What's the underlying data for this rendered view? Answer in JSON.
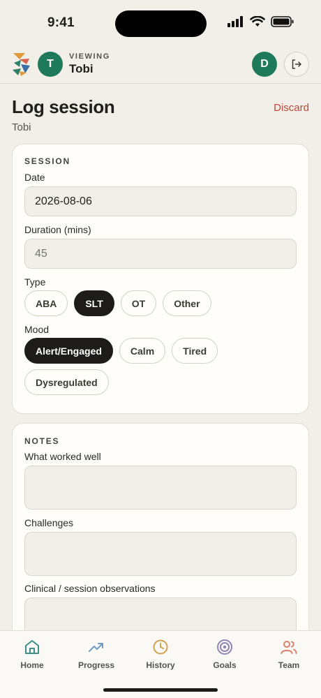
{
  "status_bar": {
    "time": "9:41"
  },
  "header": {
    "child_initial": "T",
    "viewing_label": "VIEWING",
    "child_name": "Tobi",
    "user_initial": "D"
  },
  "page": {
    "title": "Log session",
    "subtitle": "Tobi",
    "discard_label": "Discard"
  },
  "session": {
    "heading": "SESSION",
    "date_label": "Date",
    "date_value": "2026-08-06",
    "duration_label": "Duration (mins)",
    "duration_placeholder": "45",
    "type_label": "Type",
    "types": [
      {
        "label": "ABA",
        "selected": false
      },
      {
        "label": "SLT",
        "selected": true
      },
      {
        "label": "OT",
        "selected": false
      },
      {
        "label": "Other",
        "selected": false
      }
    ],
    "mood_label": "Mood",
    "moods": [
      {
        "label": "Alert/Engaged",
        "selected": true
      },
      {
        "label": "Calm",
        "selected": false
      },
      {
        "label": "Tired",
        "selected": false
      },
      {
        "label": "Dysregulated",
        "selected": false
      }
    ]
  },
  "notes": {
    "heading": "NOTES",
    "worked_label": "What worked well",
    "challenges_label": "Challenges",
    "observations_label": "Clinical / session observations"
  },
  "nav": {
    "items": [
      {
        "label": "Home",
        "icon": "home-icon",
        "color": "#3f8f86"
      },
      {
        "label": "Progress",
        "icon": "trend-up-icon",
        "color": "#6f9cc4"
      },
      {
        "label": "History",
        "icon": "clock-icon",
        "color": "#d2a04f"
      },
      {
        "label": "Goals",
        "icon": "target-icon",
        "color": "#8d86b5"
      },
      {
        "label": "Team",
        "icon": "team-icon",
        "color": "#d9806a"
      }
    ]
  },
  "colors": {
    "accent_green": "#1f7a5c",
    "discard_red": "#c0483a",
    "selected_chip": "#1d1c1a",
    "background": "#f2efe8"
  }
}
